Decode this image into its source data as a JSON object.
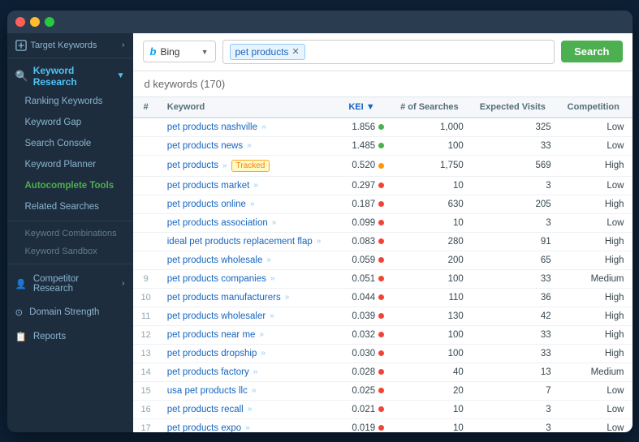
{
  "titlebar": {},
  "sidebar": {
    "top_label": "Target Keywords",
    "keyword_research_label": "Keyword Research",
    "items": [
      {
        "id": "ranking-keywords",
        "label": "Ranking Keywords",
        "active": false
      },
      {
        "id": "keyword-gap",
        "label": "Keyword Gap",
        "active": false
      },
      {
        "id": "search-console",
        "label": "Search Console",
        "active": false
      },
      {
        "id": "keyword-planner",
        "label": "Keyword Planner",
        "active": false
      },
      {
        "id": "autocomplete-tools",
        "label": "Autocomplete Tools",
        "active": true,
        "green": true
      },
      {
        "id": "related-searches",
        "label": "Related Searches",
        "active": false
      }
    ],
    "small_items": [
      {
        "id": "keyword-combinations",
        "label": "Keyword Combinations"
      },
      {
        "id": "keyword-sandbox",
        "label": "Keyword Sandbox"
      }
    ],
    "other_sections": [
      {
        "id": "competitor-research",
        "label": "Competitor Research",
        "icon": "👤"
      },
      {
        "id": "domain-strength",
        "label": "Domain Strength",
        "icon": "⊙"
      },
      {
        "id": "reports",
        "label": "Reports",
        "icon": "📋"
      }
    ]
  },
  "toolbar": {
    "engine_name": "Bing",
    "search_tag": "pet products",
    "search_button": "Search"
  },
  "content": {
    "title": "d keywords",
    "count": "(170)",
    "columns": [
      "Keyword",
      "KEI ▼",
      "# of Searches",
      "Expected Visits",
      "Competition"
    ],
    "rows": [
      {
        "num": "",
        "keyword": "pet products nashville",
        "tracked": false,
        "kei": "1.856",
        "dot": "green",
        "searches": "1,000",
        "visits": "325",
        "comp": "Low",
        "comp_class": "low"
      },
      {
        "num": "",
        "keyword": "pet products news",
        "tracked": false,
        "kei": "1.485",
        "dot": "green",
        "searches": "100",
        "visits": "33",
        "comp": "Low",
        "comp_class": "low"
      },
      {
        "num": "",
        "keyword": "pet products",
        "tracked": true,
        "kei": "0.520",
        "dot": "orange",
        "searches": "1,750",
        "visits": "569",
        "comp": "High",
        "comp_class": "high"
      },
      {
        "num": "",
        "keyword": "pet products market",
        "tracked": false,
        "kei": "0.297",
        "dot": "red",
        "searches": "10",
        "visits": "3",
        "comp": "Low",
        "comp_class": "low"
      },
      {
        "num": "",
        "keyword": "pet products online",
        "tracked": false,
        "kei": "0.187",
        "dot": "red",
        "searches": "630",
        "visits": "205",
        "comp": "High",
        "comp_class": "high"
      },
      {
        "num": "",
        "keyword": "pet products association",
        "tracked": false,
        "kei": "0.099",
        "dot": "red",
        "searches": "10",
        "visits": "3",
        "comp": "Low",
        "comp_class": "low"
      },
      {
        "num": "",
        "keyword": "ideal pet products replacement flap",
        "tracked": false,
        "kei": "0.083",
        "dot": "red",
        "searches": "280",
        "visits": "91",
        "comp": "High",
        "comp_class": "high"
      },
      {
        "num": "",
        "keyword": "pet products wholesale",
        "tracked": false,
        "kei": "0.059",
        "dot": "red",
        "searches": "200",
        "visits": "65",
        "comp": "High",
        "comp_class": "high"
      },
      {
        "num": "9",
        "keyword": "pet products companies",
        "tracked": false,
        "kei": "0.051",
        "dot": "red",
        "searches": "100",
        "visits": "33",
        "comp": "Medium",
        "comp_class": "medium"
      },
      {
        "num": "10",
        "keyword": "pet products manufacturers",
        "tracked": false,
        "kei": "0.044",
        "dot": "red",
        "searches": "110",
        "visits": "36",
        "comp": "High",
        "comp_class": "high"
      },
      {
        "num": "11",
        "keyword": "pet products wholesaler",
        "tracked": false,
        "kei": "0.039",
        "dot": "red",
        "searches": "130",
        "visits": "42",
        "comp": "High",
        "comp_class": "high"
      },
      {
        "num": "12",
        "keyword": "pet products near me",
        "tracked": false,
        "kei": "0.032",
        "dot": "red",
        "searches": "100",
        "visits": "33",
        "comp": "High",
        "comp_class": "high"
      },
      {
        "num": "13",
        "keyword": "pet products dropship",
        "tracked": false,
        "kei": "0.030",
        "dot": "red",
        "searches": "100",
        "visits": "33",
        "comp": "High",
        "comp_class": "high"
      },
      {
        "num": "14",
        "keyword": "pet products factory",
        "tracked": false,
        "kei": "0.028",
        "dot": "red",
        "searches": "40",
        "visits": "13",
        "comp": "Medium",
        "comp_class": "medium"
      },
      {
        "num": "15",
        "keyword": "usa pet products llc",
        "tracked": false,
        "kei": "0.025",
        "dot": "red",
        "searches": "20",
        "visits": "7",
        "comp": "Low",
        "comp_class": "low"
      },
      {
        "num": "16",
        "keyword": "pet products recall",
        "tracked": false,
        "kei": "0.021",
        "dot": "red",
        "searches": "10",
        "visits": "3",
        "comp": "Low",
        "comp_class": "low"
      },
      {
        "num": "17",
        "keyword": "pet products expo",
        "tracked": false,
        "kei": "0.019",
        "dot": "red",
        "searches": "10",
        "visits": "3",
        "comp": "Low",
        "comp_class": "low"
      }
    ]
  }
}
